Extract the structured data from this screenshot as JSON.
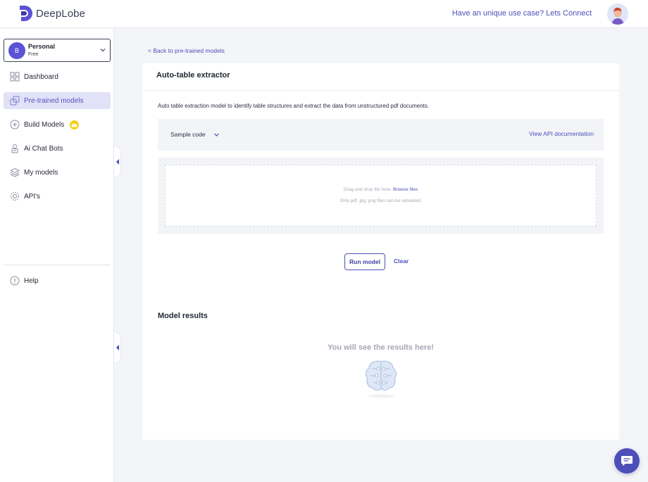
{
  "header": {
    "logo_text": "DeepLobe",
    "connect_link": "Have an unique use case? Lets Connect"
  },
  "account": {
    "initial": "B",
    "name": "Personal",
    "plan": "Free"
  },
  "sidebar": {
    "items": [
      {
        "label": "Dashboard",
        "icon": "grid-icon",
        "active": false
      },
      {
        "label": "Pre-trained models",
        "icon": "models-icon",
        "active": true
      },
      {
        "label": "Build Models",
        "icon": "plus-circle-icon",
        "active": false,
        "badge": "crown-icon"
      },
      {
        "label": "Ai Chat Bots",
        "icon": "bot-icon",
        "active": false
      },
      {
        "label": "My models",
        "icon": "layers-icon",
        "active": false
      },
      {
        "label": "API's",
        "icon": "api-gear-icon",
        "active": false
      }
    ],
    "help_label": "Help"
  },
  "main": {
    "back_link": "< Back to pre-trained models",
    "title": "Auto-table extractor",
    "description": "Auto table extraction model to identify table structures and extract the data from unstructured pdf documents.",
    "sample_code_label": "Sample code",
    "api_doc_link": "View API documentation",
    "upload": {
      "drag_text": "Drag and drop file here.",
      "browse_text": "Browse files",
      "formats_text": "Only pdf, jpg, png files can be uploaded."
    },
    "run_button": "Run model",
    "clear_button": "Clear",
    "results_title": "Model results",
    "results_empty": "You will see the results here!"
  },
  "colors": {
    "accent": "#4d4fb8",
    "active_nav_bg": "#e1e1f7",
    "crown": "#f6cf16"
  }
}
